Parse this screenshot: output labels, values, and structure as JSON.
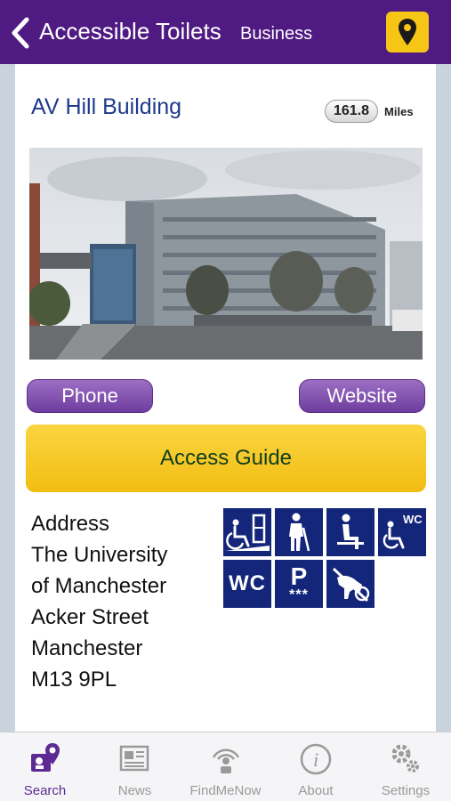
{
  "header": {
    "title": "Accessible Toilets",
    "subtitle": "Business",
    "back_icon": "chevron-left-icon",
    "map_pin_icon": "map-pin-icon"
  },
  "place": {
    "name": "AV Hill Building",
    "distance_value": "161.8",
    "distance_unit": "Miles"
  },
  "actions": {
    "phone_label": "Phone",
    "website_label": "Website",
    "access_guide_label": "Access Guide"
  },
  "address": {
    "heading": "Address",
    "lines": [
      "The University",
      "of Manchester",
      "Acker Street",
      "Manchester",
      "M13 9PL"
    ]
  },
  "facility_icons": {
    "wc_label": "WC",
    "parking_label": "P",
    "parking_stars": "***",
    "items": [
      "wheelchair-lift-icon",
      "walking-aid-icon",
      "seated-person-icon",
      "accessible-wc-icon",
      "wc-icon",
      "disabled-parking-icon",
      "no-dogs-icon"
    ]
  },
  "tabs": [
    {
      "label": "Search",
      "icon": "search-pin-icon",
      "active": true
    },
    {
      "label": "News",
      "icon": "newspaper-icon",
      "active": false
    },
    {
      "label": "FindMeNow",
      "icon": "broadcast-icon",
      "active": false
    },
    {
      "label": "About",
      "icon": "info-icon",
      "active": false
    },
    {
      "label": "Settings",
      "icon": "gears-icon",
      "active": false
    }
  ],
  "colors": {
    "header_bg": "#4f1a82",
    "accent_yellow": "#f6c515",
    "pill_purple": "#7b4aa9",
    "icon_navy": "#13267a",
    "title_blue": "#1f3a8a",
    "active_tab": "#5d2a93"
  }
}
